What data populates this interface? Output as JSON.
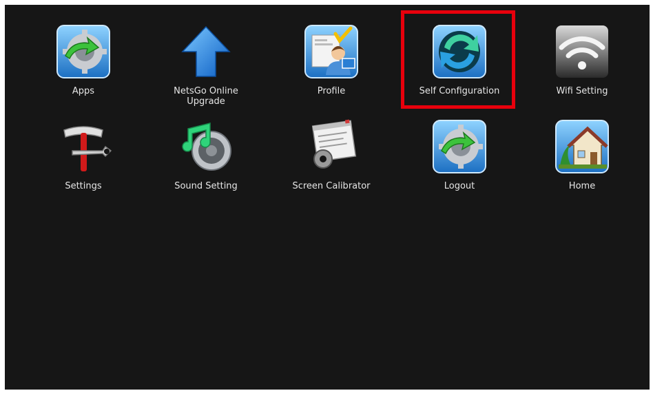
{
  "launcher": {
    "tiles": [
      {
        "label": "Apps",
        "icon": "apps-icon"
      },
      {
        "label": "NetsGo Online Upgrade",
        "icon": "upgrade-arrow-icon"
      },
      {
        "label": "Profile",
        "icon": "profile-icon"
      },
      {
        "label": "Self Configuration",
        "icon": "self-configuration-icon"
      },
      {
        "label": "Wifi Setting",
        "icon": "wifi-icon"
      },
      {
        "label": "Settings",
        "icon": "settings-tools-icon"
      },
      {
        "label": "Sound Setting",
        "icon": "sound-icon"
      },
      {
        "label": "Screen Calibrator",
        "icon": "screen-calibrator-icon"
      },
      {
        "label": "Logout",
        "icon": "logout-icon"
      },
      {
        "label": "Home",
        "icon": "home-icon"
      }
    ]
  },
  "colors": {
    "background": "#161616",
    "highlight_border": "#e8000c",
    "label_text": "#e6e6e6"
  }
}
